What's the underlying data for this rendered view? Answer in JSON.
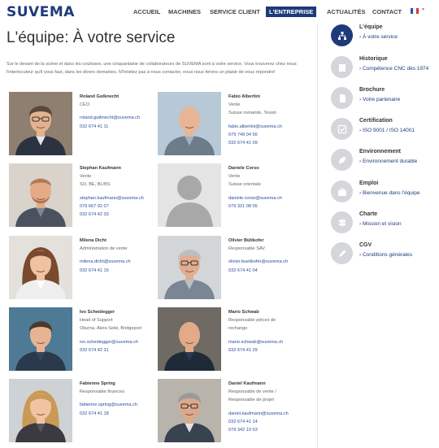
{
  "brand": {
    "logo_text": "SUVEMA",
    "color": "#1e3a7a"
  },
  "nav": {
    "items": [
      {
        "label": "ACCUEIL",
        "active": false
      },
      {
        "label": "MACHINES",
        "active": false
      },
      {
        "label": "SERVICE CLIENT",
        "active": false
      },
      {
        "label": "L'ENTREPRISE",
        "active": true
      },
      {
        "label": "ACTUALITÉS",
        "active": false
      },
      {
        "label": "CONTACT",
        "active": false
      }
    ],
    "language_flag": "fr-flag-icon"
  },
  "main": {
    "title": "L'équipe: À votre service",
    "intro": "Sur le devant de la scène et dans les coulisses, une cinquantaine de collaborateurs de SUVEMA sont à votre service. Vous trouverez chez nous l'interlocuteur qu'il vous faut, dans les divers domaines. N'hésitez pas à nous contacter, nous nous ferons un plaisir de vous répondre!"
  },
  "team": [
    {
      "name": "Roland Gutknecht",
      "lines": [
        "CEO"
      ],
      "email": "roland.gutknecht@suvema.ch",
      "phones": [
        "032 674 41 11"
      ],
      "photo": "man-glasses-suit"
    },
    {
      "name": "Fabio Albertini",
      "lines": [
        "Vente",
        "Suisse romande, Tessin"
      ],
      "email": "fabio.albertini@suvema.ch",
      "phones": [
        "079 749 04 56",
        "032 674 41 09"
      ],
      "photo": "man-bald-smile"
    },
    {
      "name": "Stephan Kaufmann",
      "lines": [
        "Vente",
        "SO, BE, BL/BS"
      ],
      "email": "stephan.kaufmann@suvema.ch",
      "phones": [
        "079 667 92 07",
        "032 674 42 33"
      ],
      "photo": "man-beard"
    },
    {
      "name": "Daniele Corso",
      "lines": [
        "Vente",
        "Suisse orientale"
      ],
      "email": "daniele.corso@suvema.ch",
      "phones": [
        "079 321 08 05"
      ],
      "photo": "placeholder-avatar"
    },
    {
      "name": "Milena Dicht",
      "lines": [
        "Administration de vente"
      ],
      "email": "milena.dicht@suvema.ch",
      "phones": [
        "032 674 41 16"
      ],
      "photo": "woman-long-hair"
    },
    {
      "name": "Olivier Bütikofer",
      "lines": [
        "Responsable SAV"
      ],
      "email": "olivier.buetikofer@suvema.ch",
      "phones": [
        "032 674 41 04"
      ],
      "photo": "man-glasses-grey"
    },
    {
      "name": "Ivo Scheidegger",
      "lines": [
        "Head of Support",
        "Okuma, Akira Seiki, Bridgeport"
      ],
      "email": "ivo.scheidegger@suvema.ch",
      "phones": [
        "032 674 42 31"
      ],
      "photo": "man-short-hair"
    },
    {
      "name": "Mario Schwab",
      "lines": [
        "Responsable pièces de",
        "rechange"
      ],
      "email": "mario.schwab@suvema.ch",
      "phones": [
        "032 674 41 29"
      ],
      "photo": "man-bald-shirt"
    },
    {
      "name": "Fabienne Spring",
      "lines": [
        "Responsable finances"
      ],
      "email": "fabienne.spring@suvema.ch",
      "phones": [
        "032 674 41 18"
      ],
      "photo": "woman-blonde"
    },
    {
      "name": "Daniel Kaufmann",
      "lines": [
        "Responsable de vente /",
        "Responsable de projet"
      ],
      "email": "daniel.kaufmann@suvema.ch",
      "phones": [
        "032 674 41 14",
        "079 342 10 63"
      ],
      "photo": "man-glasses-older"
    }
  ],
  "sidebar": {
    "items": [
      {
        "title": "L'équipe",
        "sub": "À votre service",
        "icon": "org-chart-icon",
        "active": true
      },
      {
        "title": "Historique",
        "sub": "Compétence CNC dès 1974",
        "icon": "book-icon",
        "active": false
      },
      {
        "title": "Brochure",
        "sub": "Votre partenaire",
        "icon": "brochure-icon",
        "active": false
      },
      {
        "title": "Certification",
        "sub": "ISO 9001 / ISO 14001",
        "icon": "checkbox-icon",
        "active": false
      },
      {
        "title": "Environnement",
        "sub": "Environnement durable",
        "icon": "leaf-icon",
        "active": false
      },
      {
        "title": "Emploi",
        "sub": "Bienvenue dans l'équipe",
        "icon": "briefcase-icon",
        "active": false
      },
      {
        "title": "Charte",
        "sub": "Mission et vision",
        "icon": "signpost-icon",
        "active": false
      },
      {
        "title": "CGV",
        "sub": "Conditions générales",
        "icon": "pencil-icon",
        "active": false
      }
    ]
  }
}
